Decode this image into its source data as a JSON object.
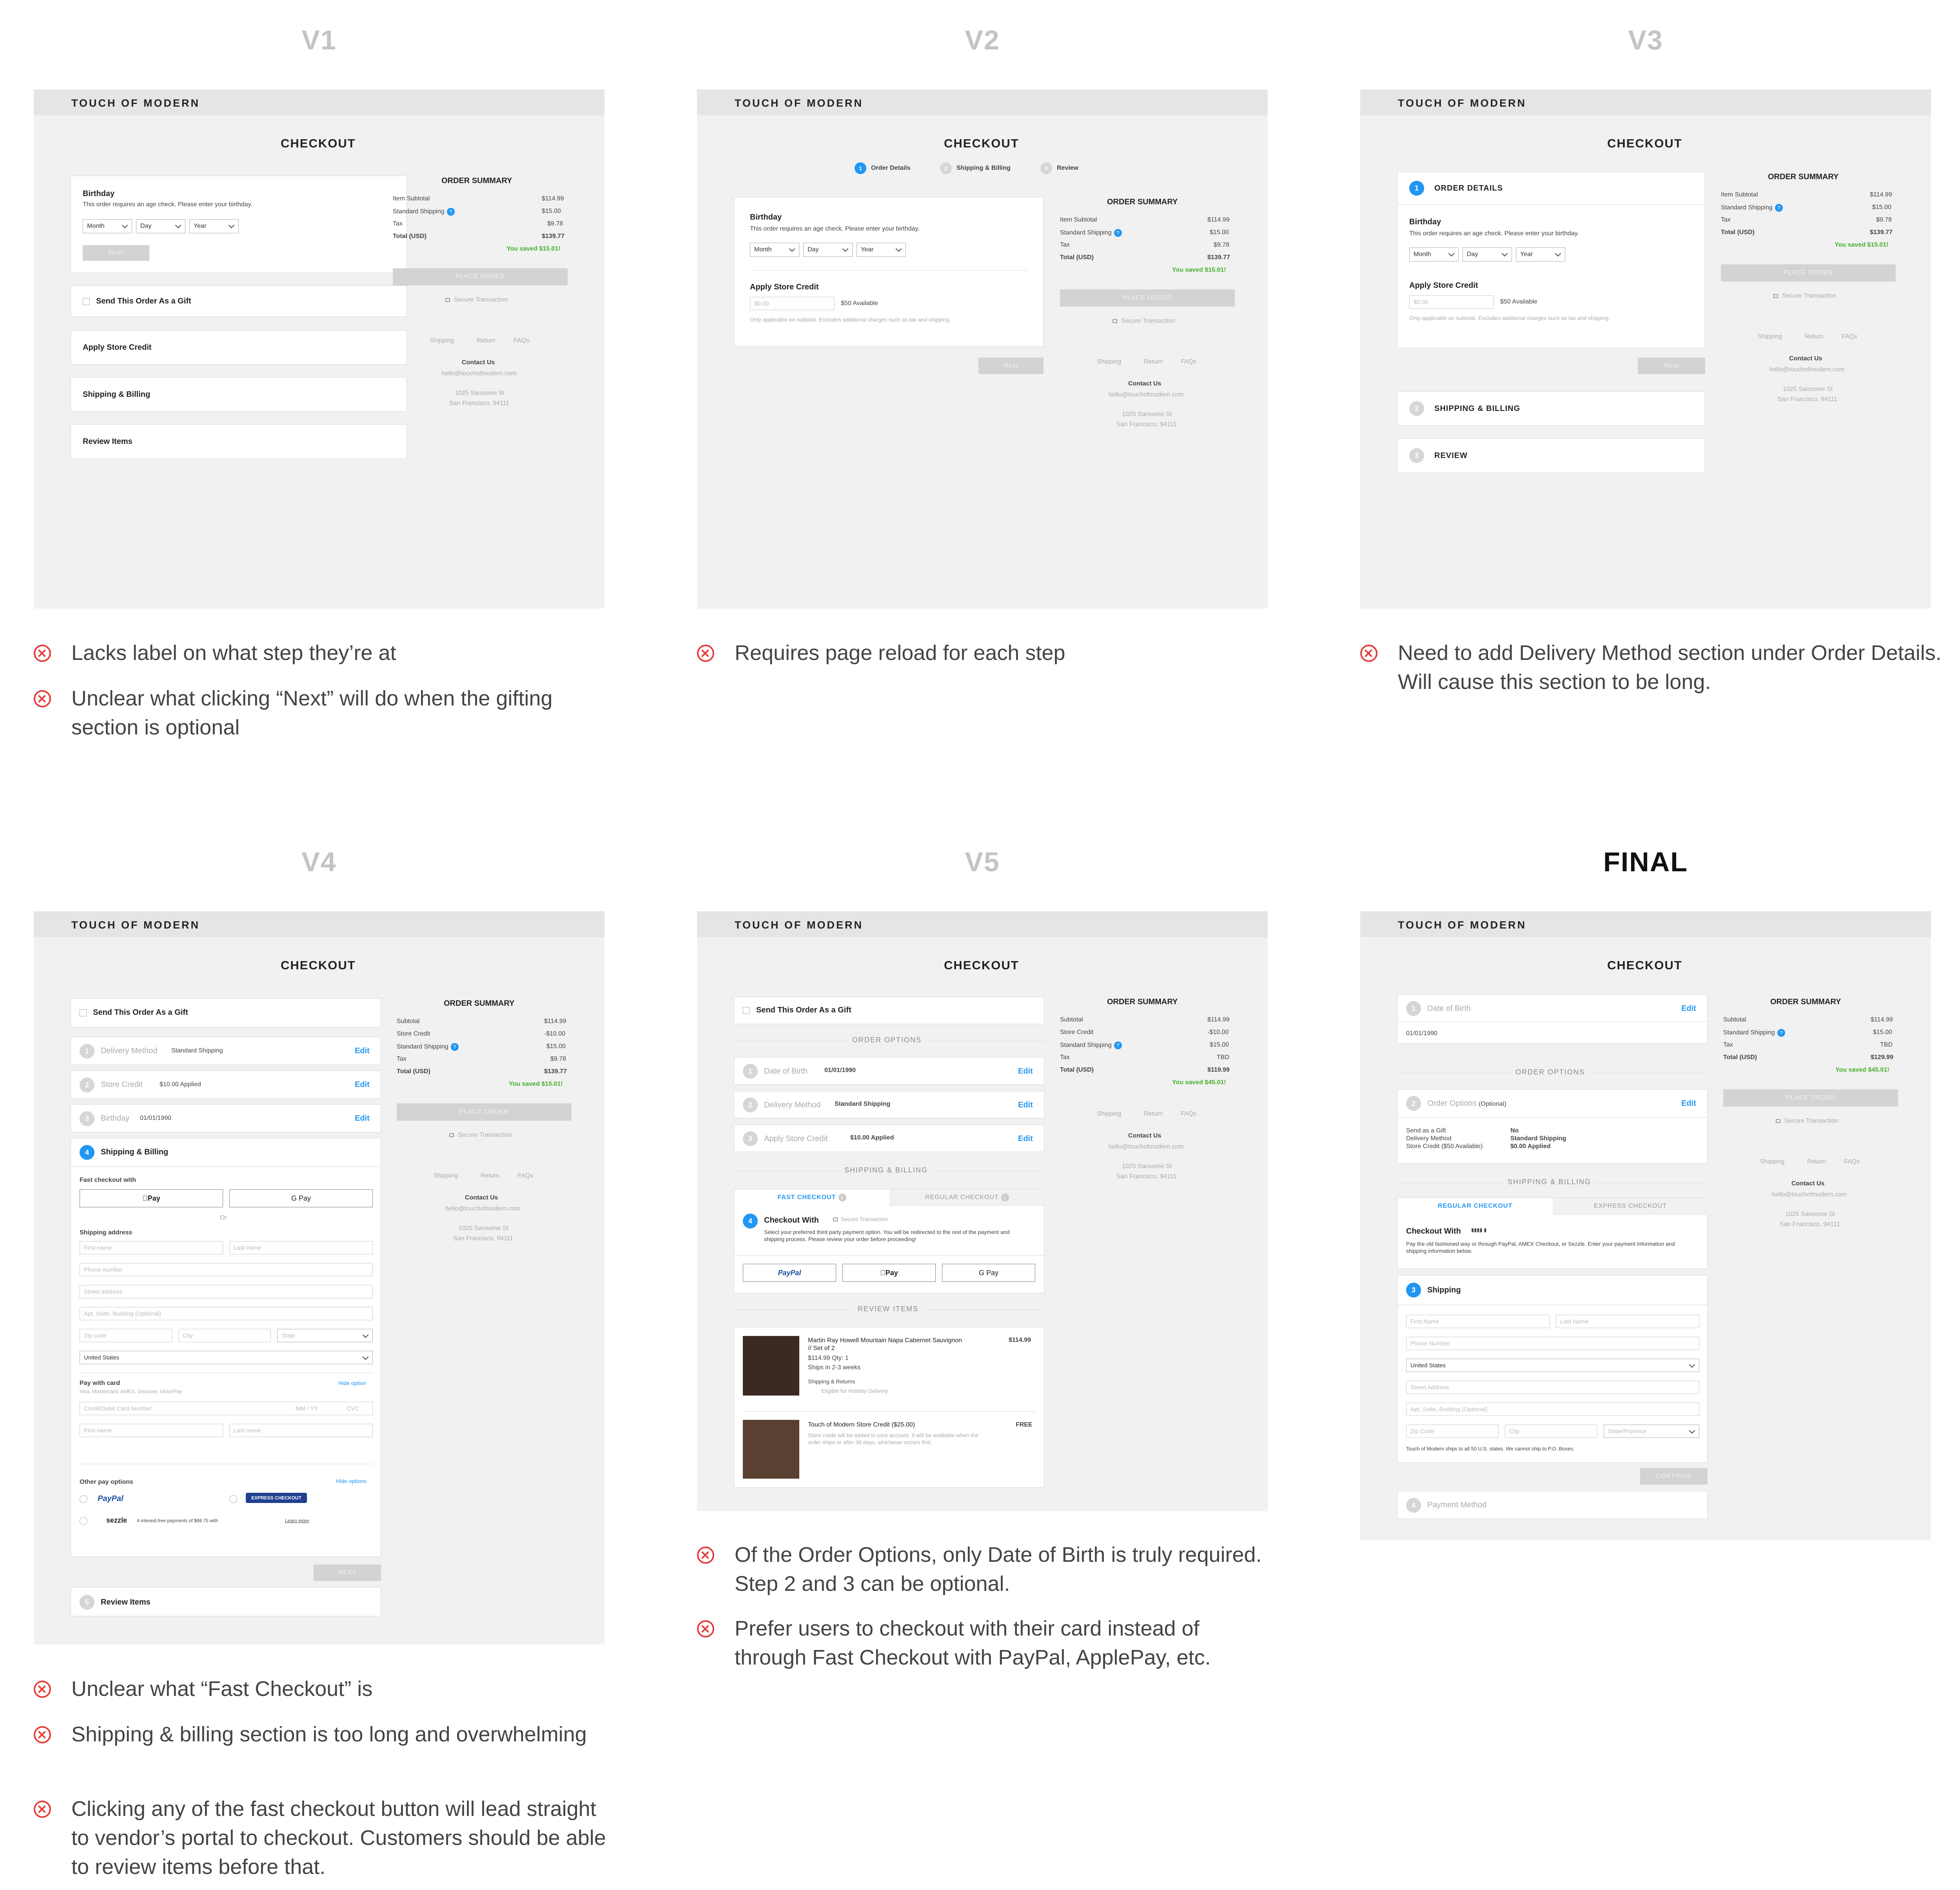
{
  "titles": {
    "v1": "V1",
    "v2": "V2",
    "v3": "V3",
    "v4": "V4",
    "v5": "V5",
    "final": "FINAL"
  },
  "brand": "TOUCH OF MODERN",
  "checkout": "CHECKOUT",
  "summary": {
    "title": "ORDER SUMMARY",
    "item_subtotal": "Item Subtotal",
    "subtotal": "Subtotal",
    "standard_shipping": "Standard Shipping",
    "store_credit": "Store Credit",
    "tax": "Tax",
    "total": "Total (USD)",
    "v_item": "$114.99",
    "v_ship": "$15.00",
    "v_tax": "$9.78",
    "v_total": "$139.77",
    "v_credit": "-$10.00",
    "tbd": "TBD",
    "v5_total": "$119.99",
    "final_total": "$129.99",
    "saved1": "You saved $15.01!",
    "saved45": "You saved $45.01!",
    "place": "PLACE ORDER",
    "secure": "Secure Transaction"
  },
  "footer": {
    "shipping": "Shipping",
    "return": "Return",
    "faqs": "FAQs",
    "contact": "Contact Us",
    "email": "hello@touchofmodern.com",
    "addr1": "1025 Sansome St",
    "addr2": "San Francisco, 94111"
  },
  "bday": {
    "title": "Birthday",
    "desc": "This order requires an age check. Please enter your birthday.",
    "month": "Month",
    "day": "Day",
    "year": "Year",
    "next": "Next"
  },
  "credit": {
    "title": "Apply Store Credit",
    "placeholder": "$0.00",
    "available": "$50 Available",
    "desc": "Only applicable on subtotal. Excludes additional charges such as tax and shipping."
  },
  "v1": {
    "gift": "Send This Order As a Gift",
    "credit": "Apply Store Credit",
    "ship": "Shipping & Billing",
    "review": "Review Items",
    "notes": [
      "Lacks label on what step they’re at",
      "Unclear what clicking “Next” will do when the gifting section is optional"
    ]
  },
  "v2": {
    "steps": [
      "Order Details",
      "Shipping & Billing",
      "Review"
    ],
    "notes": [
      "Requires page reload for each step"
    ]
  },
  "v3": {
    "s1": "ORDER DETAILS",
    "s2": "SHIPPING & BILLING",
    "s3": "REVIEW",
    "notes": [
      "Need to add Delivery Method section under Order Details. Will cause this section to be long."
    ]
  },
  "v4": {
    "gift": "Send This Order As a Gift",
    "dm_l": "Delivery Method",
    "dm_v": "Standard Shipping",
    "sc_l": "Store Credit",
    "sc_v": "$10.00 Applied",
    "bd_l": "Birthday",
    "bd_v": "01/01/1990",
    "edit": "Edit",
    "sb": "Shipping & Billing",
    "fast": "Fast checkout with",
    "apay": "Pay",
    "gpay": "G Pay",
    "or": "Or",
    "addr": "Shipping address",
    "first": "First name",
    "last": "Last name",
    "phone": "Phone number",
    "street": "Street address",
    "apt": "Apt, Suite, Building (Optional)",
    "zip": "Zip code",
    "city": "City",
    "state": "State",
    "country": "United States",
    "pwc": "Pay with card",
    "cards": "Visa, Mastercard, AMEX, Discover, UnionPay",
    "hide": "Hide option",
    "cardnum": "Credit/Debit Card Number",
    "mmyy": "MM / YY",
    "cvc": "CVC",
    "other": "Other pay options",
    "hide2": "Hide options",
    "paypal": "PayPal",
    "amex": "EXPRESS CHECKOUT",
    "sezzle": "sezzle",
    "sezzle_d": "4 interest-free payments of $68.75 with",
    "learn": "Learn more",
    "next": "NEXT",
    "review": "Review Items",
    "notes": [
      "Unclear what “Fast Checkout” is",
      "Shipping & billing section is too long and overwhelming",
      "Clicking any of the fast checkout button will lead straight to vendor’s portal to checkout. Customers should be able to review items before that."
    ]
  },
  "v5": {
    "gift": "Send This Order As a Gift",
    "opts": "ORDER OPTIONS",
    "dob_l": "Date of Birth",
    "dob_v": "01/01/1990",
    "dm_l": "Delivery Method",
    "dm_v": "Standard Shipping",
    "sc_l": "Apply Store Credit",
    "sc_v": "$10.00 Applied",
    "edit": "Edit",
    "sb": "SHIPPING & BILLING",
    "fast_tab": "FAST CHECKOUT",
    "reg_tab": "REGULAR CHECKOUT",
    "cw": "Checkout With",
    "cw_desc": "Select your preferred third party payment option. You will be redirected to the rest of the payment and shipping process. Please review your order before proceeding!",
    "paypal": "PayPal",
    "apay": "Pay",
    "gpay": "G Pay",
    "ri": "REVIEW ITEMS",
    "p1": "Martin Ray Howell Mountain Napa Cabernet Sauvignon // Set of 2",
    "p1_price": "$114.99",
    "p1_q": "$114.99   Qty: 1",
    "p1_ships": "Ships in 2-3 weeks",
    "p1_sr": "Shipping & Returns",
    "p1_hol": "Eligible for Holiday Delivery",
    "p2": "Touch of Modern Store Credit ($25.00)",
    "p2_price": "FREE",
    "p2_desc": "Store credit will be added to your account. It will be available when the order ships or after 30 days, whichever occurs first.",
    "notes": [
      "Of the Order Options, only Date of Birth is truly required. Step 2 and 3 can be optional.",
      "Prefer users to checkout with their card instead of through Fast Checkout with PayPal, ApplePay, etc."
    ]
  },
  "final": {
    "dob_l": "Date of Birth",
    "dob_v": "01/01/1990",
    "edit": "Edit",
    "opts": "ORDER OPTIONS",
    "oo_l": "Order Options",
    "oo_opt": "(Optional)",
    "gift_l": "Send as a Gift",
    "gift_v": "No",
    "dm_l": "Delivery Method",
    "dm_v": "Standard Shipping",
    "sc_l": "Store Credit ($50 Available)",
    "sc_v": "$0.00 Applied",
    "sb": "SHIPPING & BILLING",
    "reg_tab": "REGULAR CHECKOUT",
    "exp_tab": "EXPRESS CHECKOUT",
    "cw": "Checkout With",
    "cw_desc": "Pay the old fashioned way or through PayPal, AMEX Checkout, or Sezzle. Enter your payment information and shipping information below.",
    "ship": "Shipping",
    "first": "First Name",
    "last": "Last Name",
    "phone": "Phone Number",
    "country": "United States",
    "street": "Street Address",
    "apt": "Apt, Suite, Building (Optional)",
    "zip": "Zip Code",
    "city": "City",
    "state": "State/Province",
    "ship_note": "Touch of Modern ships to all 50 U.S. states. We cannot ship to P.O. Boxes.",
    "cont": "CONTINUE",
    "pm": "Payment Method"
  }
}
